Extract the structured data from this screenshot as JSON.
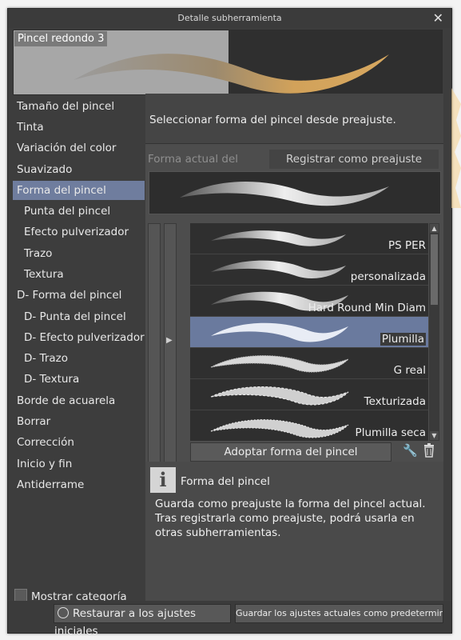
{
  "window": {
    "title": "Detalle subherramienta",
    "close_icon": "close-icon"
  },
  "preview": {
    "name": "Pincel redondo 3"
  },
  "categories": [
    {
      "label": "Tamaño del pincel",
      "level": "top"
    },
    {
      "label": "Tinta",
      "level": "top"
    },
    {
      "label": "Variación del color",
      "level": "top"
    },
    {
      "label": "Suavizado",
      "level": "top"
    },
    {
      "label": "Forma del pincel",
      "level": "top",
      "selected": true
    },
    {
      "label": "Punta del pincel",
      "level": "sub"
    },
    {
      "label": "Efecto pulverizador",
      "level": "sub"
    },
    {
      "label": "Trazo",
      "level": "sub"
    },
    {
      "label": "Textura",
      "level": "sub"
    },
    {
      "label": "D- Forma del pincel",
      "level": "top"
    },
    {
      "label": "D- Punta del pincel",
      "level": "sub"
    },
    {
      "label": "D- Efecto pulverizador",
      "level": "sub"
    },
    {
      "label": "D- Trazo",
      "level": "sub"
    },
    {
      "label": "D- Textura",
      "level": "sub"
    },
    {
      "label": "Borde de acuarela",
      "level": "top"
    },
    {
      "label": "Borrar",
      "level": "top"
    },
    {
      "label": "Corrección",
      "level": "top"
    },
    {
      "label": "Inicio y fin",
      "level": "top"
    },
    {
      "label": "Antiderrame",
      "level": "top"
    }
  ],
  "show_category": {
    "label": "Mostrar categoría",
    "checked": false
  },
  "shape_panel": {
    "header": "Seleccionar forma del pincel desde preajuste.",
    "tab_current": "Forma actual del pincel",
    "tab_register": "Registrar como preajuste",
    "presets": [
      {
        "name": "PS PER",
        "selected": false
      },
      {
        "name": "personalizada",
        "selected": false
      },
      {
        "name": "Hard Round Min Diam",
        "selected": false
      },
      {
        "name": "Plumilla",
        "selected": true
      },
      {
        "name": "G real",
        "selected": false
      },
      {
        "name": "Texturizada",
        "selected": false
      },
      {
        "name": "Plumilla seca",
        "selected": false
      }
    ],
    "adopt_button": "Adoptar forma del pincel"
  },
  "info": {
    "heading": "Forma del pincel",
    "body": "Guarda como preajuste la forma del pincel actual. Tras registrarla como preajuste, podrá usarla en otras subherramientas."
  },
  "footer": {
    "restore_button": "Restaurar a los ajustes iniciales",
    "save_button": "Guardar los ajustes actuales como predeterminados"
  }
}
